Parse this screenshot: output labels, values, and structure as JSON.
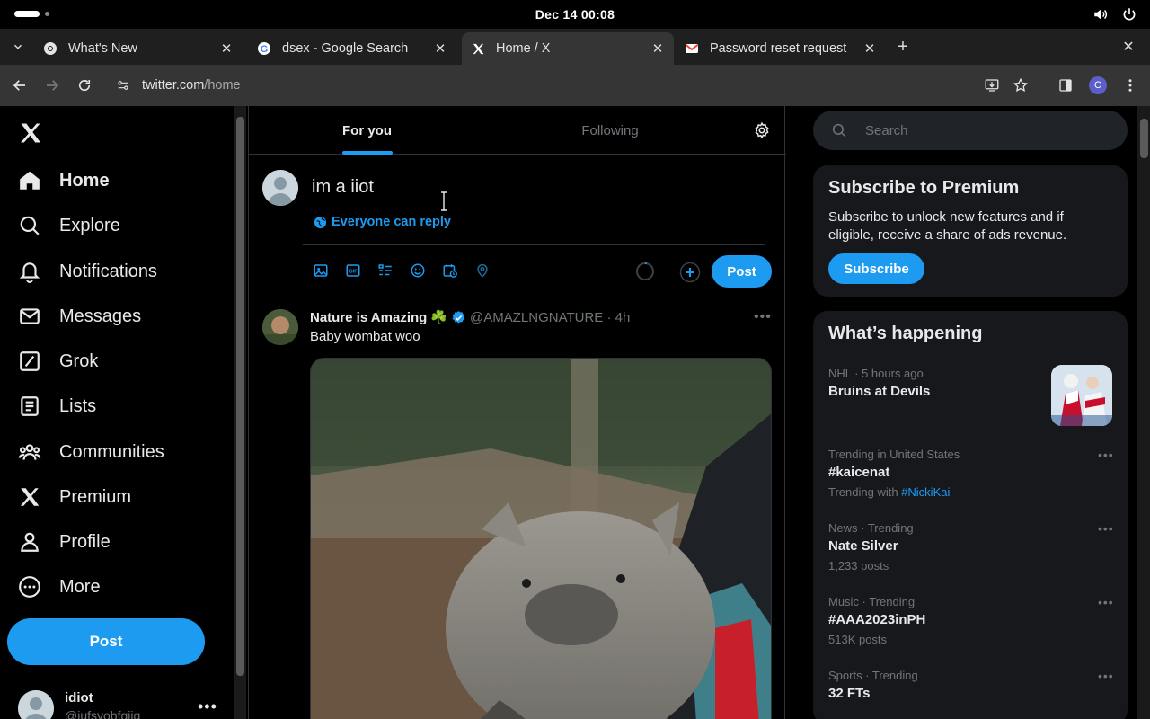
{
  "os": {
    "clock": "Dec 14  00:08"
  },
  "browser": {
    "tabs": [
      {
        "title": "What's New",
        "icon": "chrome-icon"
      },
      {
        "title": "dsex - Google Search",
        "icon": "google-icon"
      },
      {
        "title": "Home / X",
        "icon": "x-icon",
        "active": true
      },
      {
        "title": "Password reset request",
        "icon": "gmail-icon"
      }
    ],
    "url_host": "twitter.com",
    "url_path": "/home",
    "profile_initial": "C"
  },
  "nav": {
    "items": [
      {
        "label": "Home",
        "icon": "home-icon"
      },
      {
        "label": "Explore",
        "icon": "search-icon"
      },
      {
        "label": "Notifications",
        "icon": "bell-icon"
      },
      {
        "label": "Messages",
        "icon": "mail-icon"
      },
      {
        "label": "Grok",
        "icon": "grok-icon"
      },
      {
        "label": "Lists",
        "icon": "list-icon"
      },
      {
        "label": "Communities",
        "icon": "communities-icon"
      },
      {
        "label": "Premium",
        "icon": "x-icon"
      },
      {
        "label": "Profile",
        "icon": "person-icon"
      },
      {
        "label": "More",
        "icon": "more-circle-icon"
      }
    ],
    "post_label": "Post",
    "account_name": "idiot",
    "account_handle": "@iufsyobfgiig"
  },
  "feed": {
    "tab_for_you": "For you",
    "tab_following": "Following",
    "composer_text": "im a iiot",
    "reply_setting": "Everyone can reply",
    "post_label": "Post"
  },
  "tweet": {
    "name": "Nature is Amazing",
    "emoji": "☘️",
    "handle": "@AMAZLNGNATURE",
    "time": "4h",
    "text": "Baby wombat woo"
  },
  "sidebar": {
    "search_placeholder": "Search",
    "premium_title": "Subscribe to Premium",
    "premium_text": "Subscribe to unlock new features and if eligible, receive a share of ads revenue.",
    "premium_button": "Subscribe",
    "happening_title": "What’s happening",
    "trends": [
      {
        "meta": "NHL · 5 hours ago",
        "topic": "Bruins at Devils"
      },
      {
        "meta": "Trending in United States",
        "topic": "#kaicenat",
        "sub": "Trending with ",
        "sub_tag": "#NickiKai"
      },
      {
        "meta": "News · Trending",
        "topic": "Nate Silver",
        "sub": "1,233 posts"
      },
      {
        "meta": "Music · Trending",
        "topic": "#AAA2023inPH",
        "sub": "513K posts"
      },
      {
        "meta": "Sports · Trending",
        "topic": "32 FTs"
      }
    ]
  },
  "colors": {
    "accent": "#1d9bf0",
    "background": "#000000",
    "border": "#2f3336"
  }
}
